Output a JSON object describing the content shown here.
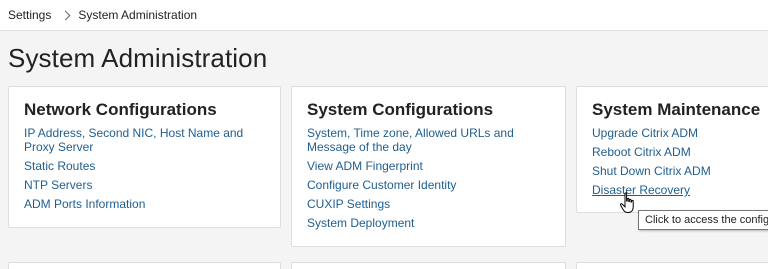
{
  "breadcrumb": {
    "root": "Settings",
    "current": "System Administration"
  },
  "page_title": "System Administration",
  "cards": {
    "network": {
      "title": "Network Configurations",
      "links": [
        "IP Address, Second NIC, Host Name and Proxy Server",
        "Static Routes",
        "NTP Servers",
        "ADM Ports Information"
      ]
    },
    "system": {
      "title": "System Configurations",
      "links": [
        "System, Time zone, Allowed URLs and Message of the day",
        "View ADM Fingerprint",
        "Configure Customer Identity",
        "CUXIP Settings",
        "System Deployment"
      ]
    },
    "maintenance": {
      "title": "System Maintenance",
      "links": [
        "Upgrade Citrix ADM",
        "Reboot Citrix ADM",
        "Shut Down Citrix ADM",
        "Disaster Recovery"
      ]
    }
  },
  "tooltip": "Click to access the configuration",
  "colors": {
    "link": "#1f5e90",
    "background": "#f4f4f4",
    "card": "#ffffff"
  },
  "icons": {
    "breadcrumb_separator": "chevron-right-icon",
    "cursor": "hand-pointer-icon"
  }
}
